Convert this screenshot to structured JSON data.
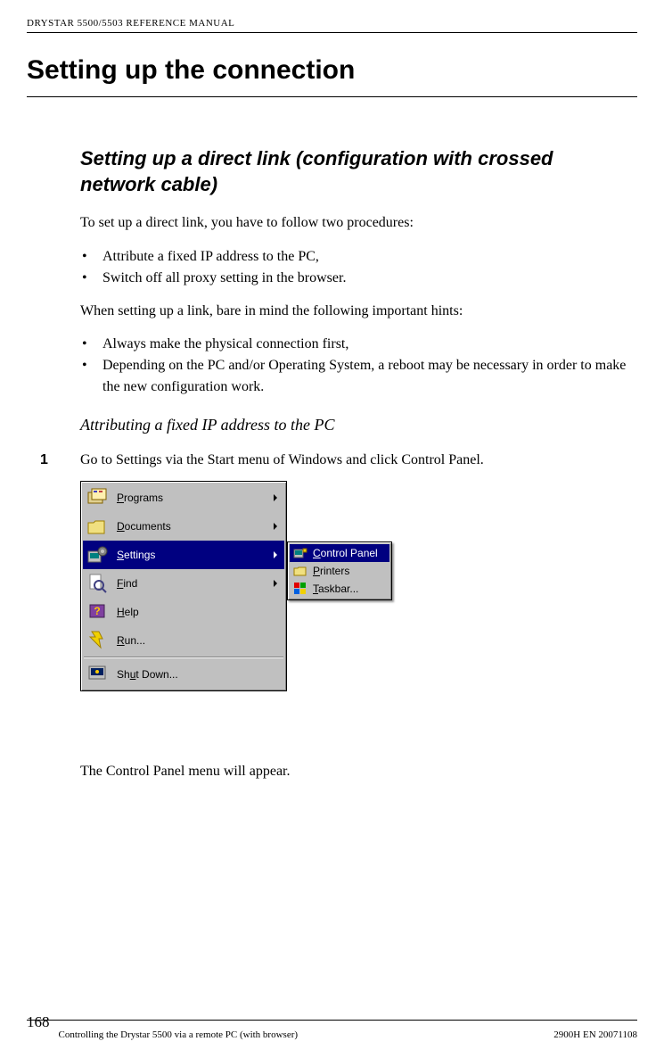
{
  "header": "DRYSTAR 5500/5503 REFERENCE MANUAL",
  "title": "Setting up the connection",
  "section_title": "Setting up a direct link (configuration with crossed network cable)",
  "intro": "To set up a direct link, you have to follow two procedures:",
  "bullets_a": [
    "Attribute a fixed IP address to the PC,",
    "Switch off all proxy setting in the browser."
  ],
  "hints_intro": "When setting up a link, bare in mind the following important hints:",
  "bullets_b": [
    "Always make the physical connection first,",
    "Depending on the PC and/or Operating System, a reboot may be necessary in order to make the new configuration work."
  ],
  "subsection": "Attributing a fixed IP address to the PC",
  "step1_num": "1",
  "step1_text": "Go to Settings via the Start menu of Windows and click Control Panel.",
  "after_img": "The Control Panel menu will appear.",
  "menu": {
    "items": [
      {
        "label_pre": "",
        "label_u": "P",
        "label_post": "rograms",
        "arrow": true
      },
      {
        "label_pre": "",
        "label_u": "D",
        "label_post": "ocuments",
        "arrow": true
      },
      {
        "label_pre": "",
        "label_u": "S",
        "label_post": "ettings",
        "arrow": true,
        "selected": true
      },
      {
        "label_pre": "",
        "label_u": "F",
        "label_post": "ind",
        "arrow": true
      },
      {
        "label_pre": "",
        "label_u": "H",
        "label_post": "elp",
        "arrow": false
      },
      {
        "label_pre": "",
        "label_u": "R",
        "label_post": "un...",
        "arrow": false
      }
    ],
    "shutdown": {
      "label_pre": "Sh",
      "label_u": "u",
      "label_post": "t Down..."
    },
    "submenu": [
      {
        "label_pre": "",
        "label_u": "C",
        "label_post": "ontrol Panel",
        "hl": true
      },
      {
        "label_pre": "",
        "label_u": "P",
        "label_post": "rinters",
        "hl": false
      },
      {
        "label_pre": "",
        "label_u": "T",
        "label_post": "askbar...",
        "hl": false
      }
    ]
  },
  "footer": {
    "page_num": "168",
    "center": "Controlling the Drystar 5500 via a remote PC (with browser)",
    "right": "2900H EN 20071108"
  }
}
